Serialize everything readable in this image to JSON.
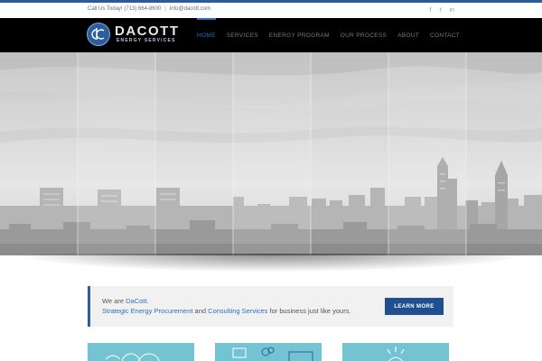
{
  "topbar": {
    "phone_text": "Call Us Today! (713) 664-8600",
    "separator": "|",
    "email_text": "info@dacott.com",
    "social": [
      {
        "icon": "facebook-icon",
        "glyph": "f"
      },
      {
        "icon": "twitter-icon",
        "glyph": "t"
      },
      {
        "icon": "linkedin-icon",
        "glyph": "in"
      }
    ]
  },
  "logo": {
    "name": "DACOTT",
    "subtitle": "ENERGY SERVICES"
  },
  "nav": {
    "items": [
      {
        "label": "HOME",
        "active": true
      },
      {
        "label": "SERVICES",
        "active": false
      },
      {
        "label": "ENERGY PROGRAM",
        "active": false
      },
      {
        "label": "OUR PROCESS",
        "active": false
      },
      {
        "label": "ABOUT",
        "active": false
      },
      {
        "label": "CONTACT",
        "active": false
      }
    ]
  },
  "tagline": {
    "line1_prefix": "We are ",
    "line1_link": "DaCott",
    "line1_suffix": ".",
    "line2_link1": "Strategic Energy Procurement",
    "line2_mid": " and ",
    "line2_link2": "Consulting Services",
    "line2_suffix": " for business just like yours.",
    "button_label": "LEARN MORE"
  },
  "colors": {
    "brand_blue": "#2c5d9f",
    "nav_active": "#2f6ec0",
    "button_bg": "#1f4f8e",
    "card_teal": "#74c3d3"
  }
}
